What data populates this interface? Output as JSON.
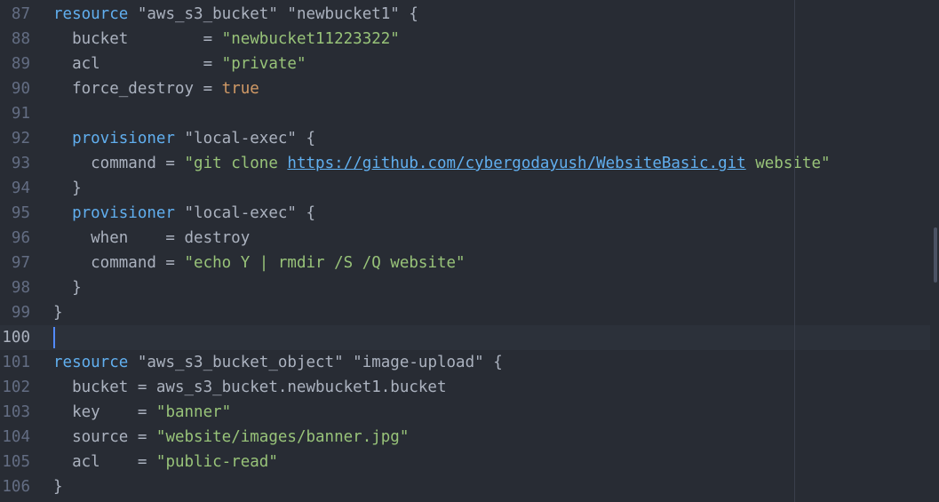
{
  "editor": {
    "colors": {
      "background": "#282c34",
      "keyword": "#61afef",
      "string": "#98c379",
      "boolean": "#d19a66",
      "plain": "#abb2bf",
      "line_number": "#636d83",
      "cursor": "#528bff"
    },
    "lines": [
      {
        "number": "87",
        "tokens": [
          {
            "text": "resource",
            "type": "keyword"
          },
          {
            "text": " \"aws_s3_bucket\" \"newbucket1\" {",
            "type": "plain"
          }
        ]
      },
      {
        "number": "88",
        "tokens": [
          {
            "text": "  bucket        = ",
            "type": "plain"
          },
          {
            "text": "\"newbucket11223322\"",
            "type": "string"
          }
        ]
      },
      {
        "number": "89",
        "tokens": [
          {
            "text": "  acl           = ",
            "type": "plain"
          },
          {
            "text": "\"private\"",
            "type": "string"
          }
        ]
      },
      {
        "number": "90",
        "tokens": [
          {
            "text": "  force_destroy = ",
            "type": "plain"
          },
          {
            "text": "true",
            "type": "bool"
          }
        ]
      },
      {
        "number": "91",
        "tokens": []
      },
      {
        "number": "92",
        "tokens": [
          {
            "text": "  ",
            "type": "plain"
          },
          {
            "text": "provisioner",
            "type": "keyword"
          },
          {
            "text": " \"local-exec\" {",
            "type": "plain"
          }
        ]
      },
      {
        "number": "93",
        "tokens": [
          {
            "text": "    command = ",
            "type": "plain"
          },
          {
            "text": "\"git clone ",
            "type": "string"
          },
          {
            "text": "https://github.com/cybergodayush/WebsiteBasic.git",
            "type": "link"
          },
          {
            "text": " website\"",
            "type": "string"
          }
        ]
      },
      {
        "number": "94",
        "tokens": [
          {
            "text": "  }",
            "type": "plain"
          }
        ]
      },
      {
        "number": "95",
        "tokens": [
          {
            "text": "  ",
            "type": "plain"
          },
          {
            "text": "provisioner",
            "type": "keyword"
          },
          {
            "text": " \"local-exec\" {",
            "type": "plain"
          }
        ]
      },
      {
        "number": "96",
        "tokens": [
          {
            "text": "    when    = destroy",
            "type": "plain"
          }
        ]
      },
      {
        "number": "97",
        "tokens": [
          {
            "text": "    command = ",
            "type": "plain"
          },
          {
            "text": "\"echo Y | rmdir /S /Q website\"",
            "type": "string"
          }
        ]
      },
      {
        "number": "98",
        "tokens": [
          {
            "text": "  }",
            "type": "plain"
          }
        ]
      },
      {
        "number": "99",
        "tokens": [
          {
            "text": "}",
            "type": "plain"
          }
        ]
      },
      {
        "number": "100",
        "tokens": [],
        "active": true,
        "cursor": true
      },
      {
        "number": "101",
        "tokens": [
          {
            "text": "resource",
            "type": "keyword"
          },
          {
            "text": " \"aws_s3_bucket_object\" \"image-upload\" {",
            "type": "plain"
          }
        ]
      },
      {
        "number": "102",
        "tokens": [
          {
            "text": "  bucket = aws_s3_bucket.newbucket1.bucket",
            "type": "plain"
          }
        ]
      },
      {
        "number": "103",
        "tokens": [
          {
            "text": "  key    = ",
            "type": "plain"
          },
          {
            "text": "\"banner\"",
            "type": "string"
          }
        ]
      },
      {
        "number": "104",
        "tokens": [
          {
            "text": "  source = ",
            "type": "plain"
          },
          {
            "text": "\"website/images/banner.jpg\"",
            "type": "string"
          }
        ]
      },
      {
        "number": "105",
        "tokens": [
          {
            "text": "  acl    = ",
            "type": "plain"
          },
          {
            "text": "\"public-read\"",
            "type": "string"
          }
        ]
      },
      {
        "number": "106",
        "tokens": [
          {
            "text": "}",
            "type": "plain"
          }
        ]
      }
    ]
  }
}
